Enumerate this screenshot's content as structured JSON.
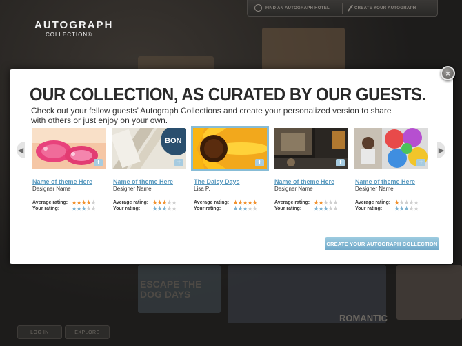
{
  "header": {
    "logo_line1": "AUTOGRAPH",
    "logo_line2": "COLLECTION®",
    "nav_find": "FIND AN AUTOGRAPH HOTEL",
    "nav_create": "CREATE YOUR AUTOGRAPH"
  },
  "footer": {
    "login": "LOG IN",
    "explore": "EXPLORE",
    "poster_escape": "ESCAPE THE",
    "poster_dog": "DOG DAYS",
    "poster_romantic": "ROMANTIC"
  },
  "modal": {
    "title": "OUR COLLECTION, AS CURATED BY OUR GUESTS.",
    "subtitle": "Check out your fellow guests’ Autograph Collections and create your personalized version to share with others or just enjoy on your own.",
    "close_symbol": "×",
    "prev_symbol": "◀",
    "next_symbol": "▶",
    "plus_symbol": "+",
    "average_rating_label": "Average rating:",
    "your_rating_label": "Your rating:",
    "create_button": "CREATE YOUR AUTOGRAPH COLLECTION",
    "cards": [
      {
        "name": "Name of theme Here",
        "designer": "Designer Name",
        "average_rating": 4,
        "your_rating": 3,
        "image": "pink-sandals"
      },
      {
        "name": "Name of theme Here",
        "designer": "Designer Name",
        "average_rating": 3,
        "your_rating": 3,
        "image": "vintage-signs"
      },
      {
        "name": "The Daisy Days",
        "designer": "Lisa P.",
        "average_rating": 5,
        "your_rating": 3,
        "image": "sunflower",
        "selected": true
      },
      {
        "name": "Name of theme Here",
        "designer": "Designer Name",
        "average_rating": 2,
        "your_rating": 3,
        "image": "dark-room"
      },
      {
        "name": "Name of theme Here",
        "designer": "Designer Name",
        "average_rating": 1,
        "your_rating": 3,
        "image": "paint-cups"
      }
    ]
  },
  "colors": {
    "accent_blue": "#5b9bc0",
    "star_orange": "#f2922f",
    "star_blue": "#7fb3d1",
    "star_empty": "#d0d0d0"
  }
}
